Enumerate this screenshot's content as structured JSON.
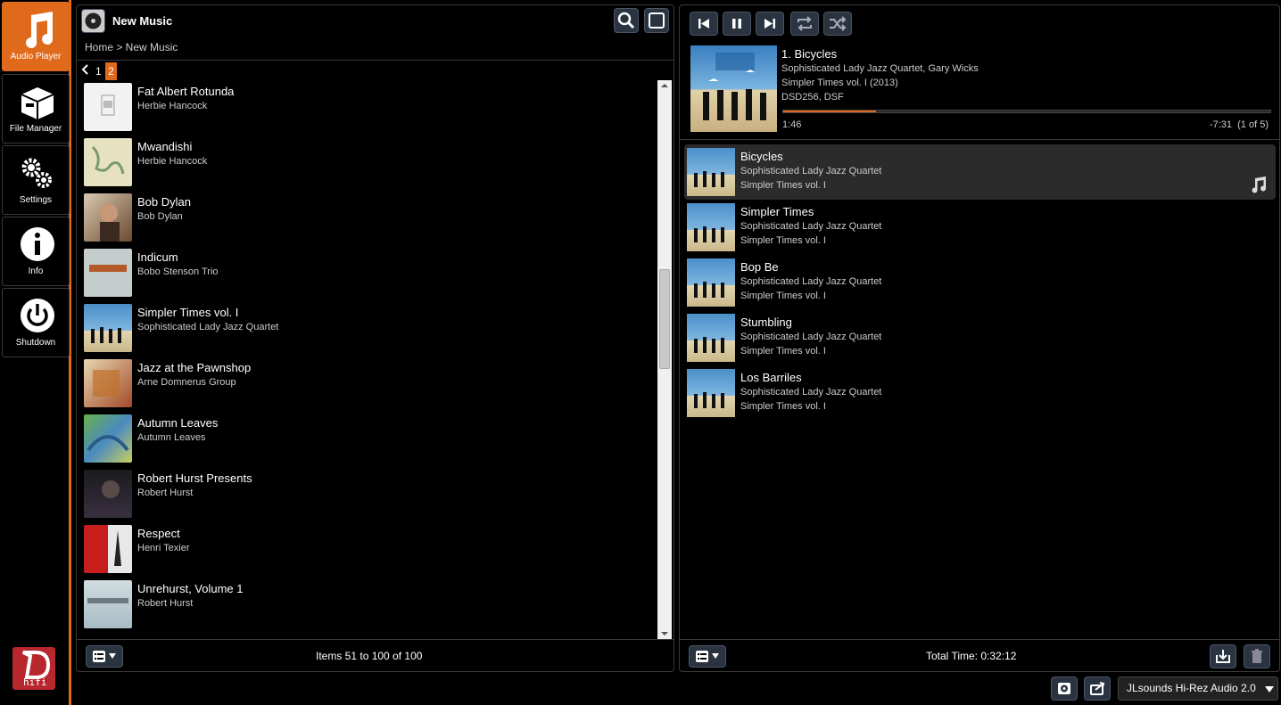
{
  "sidebar": {
    "items": [
      {
        "label": "Audio Player",
        "icon": "music-note-icon",
        "active": true
      },
      {
        "label": "File Manager",
        "icon": "box-icon",
        "active": false
      },
      {
        "label": "Settings",
        "icon": "gears-icon",
        "active": false
      },
      {
        "label": "Info",
        "icon": "info-icon",
        "active": false
      },
      {
        "label": "Shutdown",
        "icon": "power-icon",
        "active": false
      }
    ],
    "logo_text": "hifi"
  },
  "library": {
    "title": "New Music",
    "breadcrumb": "Home > New Music",
    "pager": {
      "prev": "‹",
      "page1": "1",
      "page2": "2"
    },
    "albums": [
      {
        "title": "Fat Albert Rotunda",
        "artist": "Herbie Hancock"
      },
      {
        "title": "Mwandishi",
        "artist": "Herbie Hancock"
      },
      {
        "title": "Bob Dylan",
        "artist": "Bob Dylan"
      },
      {
        "title": "Indicum",
        "artist": "Bobo Stenson Trio"
      },
      {
        "title": "Simpler Times vol. I",
        "artist": "Sophisticated Lady Jazz Quartet"
      },
      {
        "title": "Jazz at the Pawnshop",
        "artist": "Arne Domnerus Group"
      },
      {
        "title": "Autumn Leaves",
        "artist": "Autumn Leaves"
      },
      {
        "title": "Robert Hurst Presents",
        "artist": "Robert Hurst"
      },
      {
        "title": "Respect",
        "artist": "Henri Texier"
      },
      {
        "title": "Unrehurst, Volume 1",
        "artist": "Robert Hurst"
      }
    ],
    "footer": "Items 51 to 100 of 100"
  },
  "now_playing": {
    "title": "1. Bicycles",
    "artists": "Sophisticated Lady Jazz Quartet, Gary Wicks",
    "album": "Simpler Times vol. I (2013)",
    "format": "DSD256, DSF",
    "elapsed": "1:46",
    "remaining": "-7:31  (1 of 5)",
    "progress_fraction": 0.19
  },
  "queue": {
    "tracks": [
      {
        "title": "Bicycles",
        "artist": "Sophisticated Lady Jazz Quartet",
        "album": "Simpler Times vol. I",
        "current": true
      },
      {
        "title": "Simpler Times",
        "artist": "Sophisticated Lady Jazz Quartet",
        "album": "Simpler Times vol. I",
        "current": false
      },
      {
        "title": "Bop Be",
        "artist": "Sophisticated Lady Jazz Quartet",
        "album": "Simpler Times vol. I",
        "current": false
      },
      {
        "title": "Stumbling",
        "artist": "Sophisticated Lady Jazz Quartet",
        "album": "Simpler Times vol. I",
        "current": false
      },
      {
        "title": "Los Barriles",
        "artist": "Sophisticated Lady Jazz Quartet",
        "album": "Simpler Times vol. I",
        "current": false
      }
    ],
    "total_time": "Total Time: 0:32:12"
  },
  "device": {
    "name": "JLsounds Hi-Rez Audio 2.0"
  },
  "colors": {
    "accent": "#e06a1c",
    "button_bg": "#2a3340",
    "panel_border": "#3a3a3a"
  }
}
